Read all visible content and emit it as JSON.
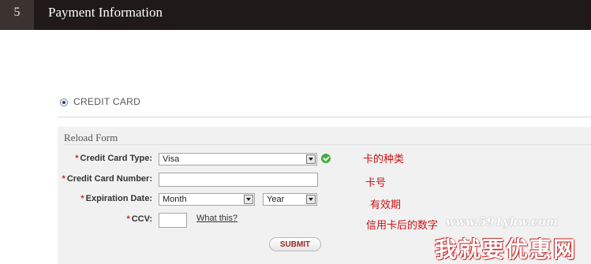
{
  "header": {
    "step_number": "5",
    "title": "Payment Information"
  },
  "payment_method": {
    "label": "CREDIT CARD",
    "selected": true
  },
  "form": {
    "title": "Reload Form",
    "required_marker": "*",
    "card_type": {
      "label": "Credit Card Type:",
      "value": "Visa",
      "note": "卡的种类"
    },
    "card_number": {
      "label": "Credit Card Number:",
      "value": "",
      "note": "卡号"
    },
    "expiration": {
      "label": "Expiration Date:",
      "month_value": "Month",
      "year_value": "Year",
      "note": "有效期"
    },
    "ccv": {
      "label": "CCV:",
      "value": "",
      "help_link": "What this?",
      "note": "信用卡后的数字"
    },
    "submit_label": "SUBMIT"
  },
  "watermark": {
    "url": "www.591yhw.com",
    "text": "我就要优惠网"
  },
  "colors": {
    "header_bg": "#1f1a17",
    "required": "#cc2a1e",
    "note": "#cc1111",
    "valid": "#3fae3a"
  }
}
